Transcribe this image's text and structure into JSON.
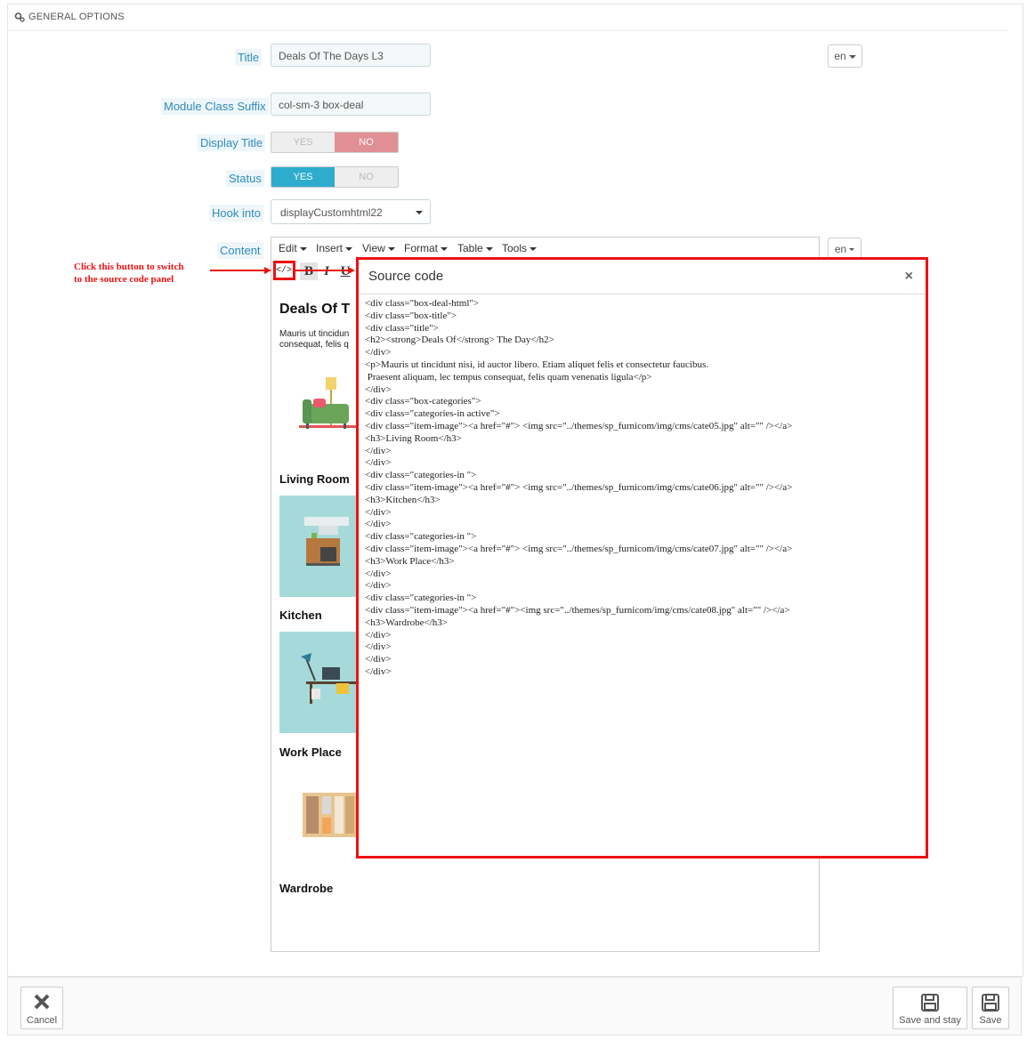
{
  "panel": {
    "heading": "GENERAL OPTIONS"
  },
  "fields": {
    "title": {
      "label": "Title",
      "value": "Deals Of The Days L3",
      "lang": "en"
    },
    "module_class_suffix": {
      "label": "Module Class Suffix",
      "value": "col-sm-3 box-deal"
    },
    "display_title": {
      "label": "Display Title",
      "yes": "YES",
      "no": "NO",
      "selected": "NO"
    },
    "status": {
      "label": "Status",
      "yes": "YES",
      "no": "NO",
      "selected": "YES"
    },
    "hook_into": {
      "label": "Hook into",
      "value": "displayCustomhtml22"
    },
    "content": {
      "label": "Content",
      "lang": "en"
    }
  },
  "editor": {
    "menus": [
      "Edit",
      "Insert",
      "View",
      "Format",
      "Table",
      "Tools"
    ],
    "toolbar": {
      "source_code": "</>",
      "bold": "B",
      "italic": "I",
      "underline": "U"
    },
    "preview": {
      "heading": "Deals Of T",
      "paragraph_line1": "Mauris ut tincidun",
      "paragraph_line2": "consequat, felis q",
      "categories": [
        "Living Room",
        "Kitchen",
        "Work Place",
        "Wardrobe"
      ]
    }
  },
  "annotation": {
    "line1": "Click this button to switch",
    "line2": "to the source code panel"
  },
  "modal": {
    "title": "Source code",
    "close": "×",
    "code": "<div class=\"box-deal-html\">\n<div class=\"box-title\">\n<div class=\"title\">\n<h2><strong>Deals Of</strong> The Day</h2>\n</div>\n<p>Mauris ut tincidunt nisi, id auctor libero. Etiam aliquet felis et consectetur faucibus.\n Praesent aliquam, lec tempus consequat, felis quam venenatis ligula</p>\n</div>\n<div class=\"box-categories\">\n<div class=\"categories-in active\">\n<div class=\"item-image\"><a href=\"#\"> <img src=\"../themes/sp_furnicom/img/cms/cate05.jpg\" alt=\"\" /></a>\n<h3>Living Room</h3>\n</div>\n</div>\n<div class=\"categories-in \">\n<div class=\"item-image\"><a href=\"#\"> <img src=\"../themes/sp_furnicom/img/cms/cate06.jpg\" alt=\"\" /></a>\n<h3>Kitchen</h3>\n</div>\n</div>\n<div class=\"categories-in \">\n<div class=\"item-image\"><a href=\"#\"> <img src=\"../themes/sp_furnicom/img/cms/cate07.jpg\" alt=\"\" /></a>\n<h3>Work Place</h3>\n</div>\n</div>\n<div class=\"categories-in \">\n<div class=\"item-image\"><a href=\"#\"><img src=\"../themes/sp_furnicom/img/cms/cate08.jpg\" alt=\"\" /></a>\n<h3>Wardrobe</h3>\n</div>\n</div>\n</div>\n</div>"
  },
  "footer": {
    "cancel": "Cancel",
    "save_and_stay": "Save and stay",
    "save": "Save"
  },
  "colors": {
    "accent_blue": "#2eacce",
    "no_red": "#e08f95",
    "annotation_red": "#ee1111",
    "label_blue": "#2e8bb8"
  }
}
